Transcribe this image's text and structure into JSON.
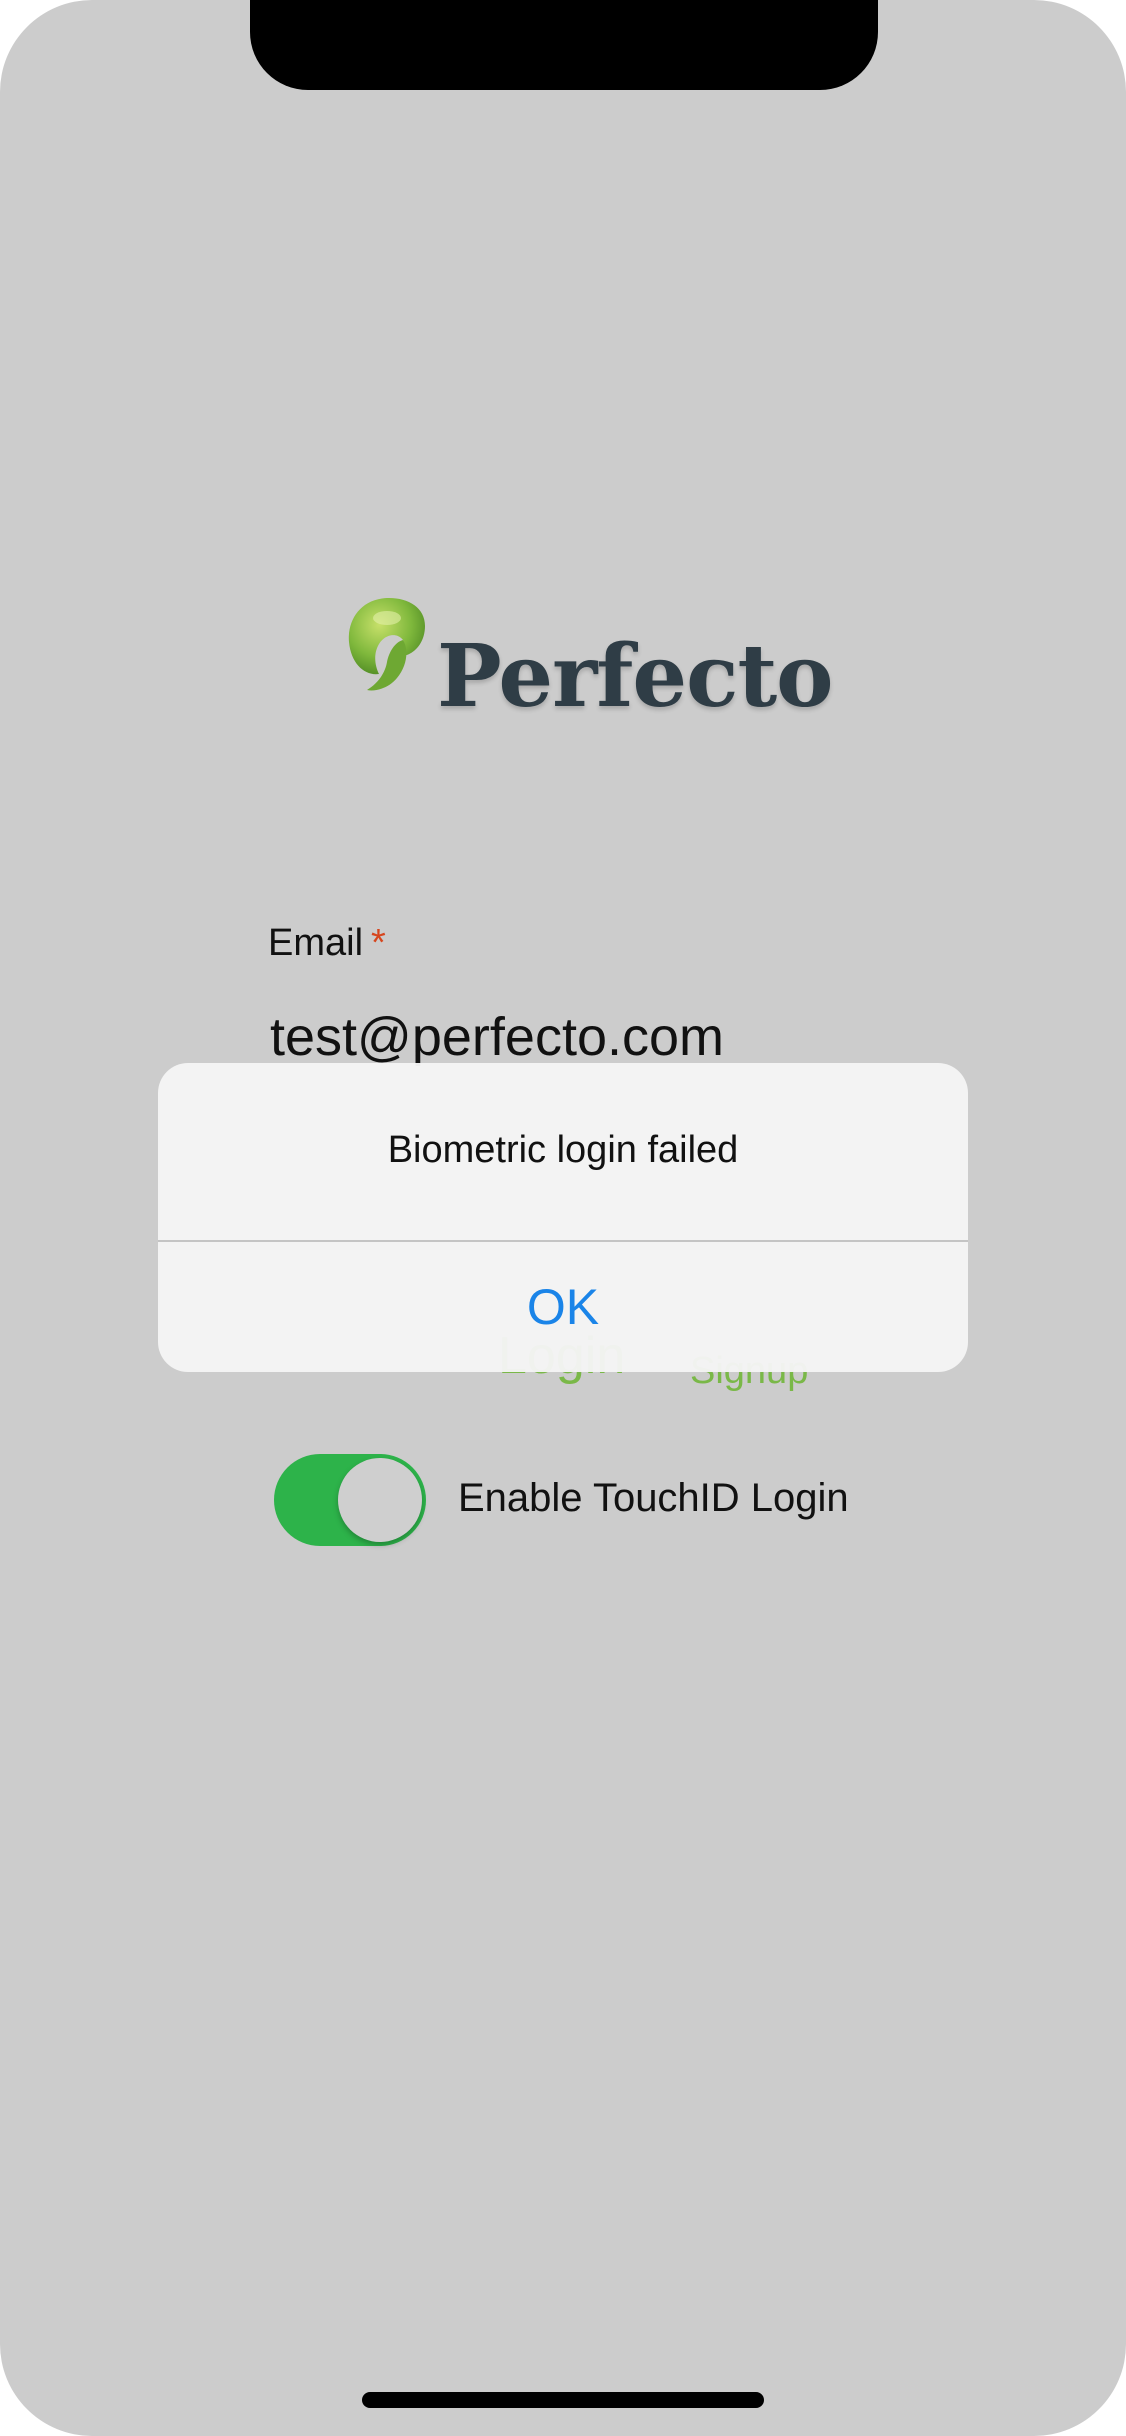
{
  "app": {
    "logo_text": "Perfecto",
    "brand_color": "#7ab848",
    "logo_icon": "perfecto-leaf-icon"
  },
  "login_form": {
    "email_label": "Email",
    "required_mark": "*",
    "email_value": "test@perfecto.com",
    "login_label": "Login",
    "signup_label": "Signup"
  },
  "touchid": {
    "label": "Enable TouchID Login",
    "enabled": true,
    "toggle_color": "#2db34a"
  },
  "alert": {
    "message": "Biometric login failed",
    "ok_label": "OK",
    "ok_color": "#1a84e8"
  }
}
